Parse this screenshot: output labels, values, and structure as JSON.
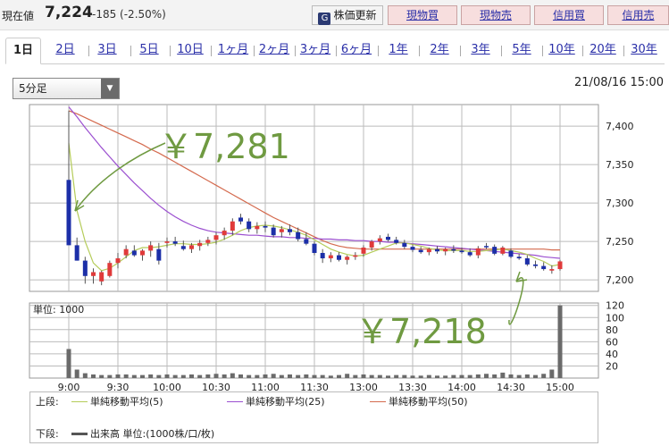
{
  "header": {
    "price_label": "現在値",
    "price": "7,224",
    "change": "-185 (-2.50%)",
    "update_label": "株価更新",
    "update_icon": "G",
    "buttons": [
      "現物買",
      "現物売",
      "信用買",
      "信用売"
    ]
  },
  "tabs": [
    "1日",
    "2日",
    "3日",
    "5日",
    "10日",
    "1ヶ月",
    "2ヶ月",
    "3ヶ月",
    "6ヶ月",
    "1年",
    "2年",
    "3年",
    "5年",
    "10年",
    "20年",
    "30年"
  ],
  "active_tab": "1日",
  "interval_select": {
    "value": "5分足",
    "arrow": "▼"
  },
  "datetime": "21/08/16 15:00",
  "annotations": {
    "high": "￥7,281",
    "low": "￥7,218"
  },
  "legend": {
    "upper_label": "上段:",
    "lower_label": "下段:",
    "items": [
      {
        "label": "単純移動平均(5)",
        "color": "#b5cc5a"
      },
      {
        "label": "単純移動平均(25)",
        "color": "#9b4fd0"
      },
      {
        "label": "単純移動平均(50)",
        "color": "#d46a4e"
      }
    ],
    "volume_item": {
      "label": "出来高 単位:(1000株/口/枚)",
      "color": "#555555"
    }
  },
  "chart_data": {
    "type": "candlestick",
    "price_axis": {
      "ticks": [
        7200,
        7250,
        7300,
        7350,
        7400
      ],
      "labels": [
        "7,200",
        "7,250",
        "7,300",
        "7,350",
        "7,400"
      ],
      "range": [
        7185,
        7428
      ]
    },
    "volume_axis": {
      "label": "単位: 1000",
      "ticks": [
        20,
        40,
        60,
        80,
        100,
        120
      ],
      "range": [
        0,
        124
      ]
    },
    "x_labels": [
      "9:00",
      "9:30",
      "10:00",
      "10:30",
      "11:00",
      "11:30",
      "13:00",
      "13:30",
      "14:00",
      "14:30",
      "15:00"
    ],
    "x_label_index": [
      0,
      6,
      12,
      18,
      24,
      30,
      36,
      42,
      48,
      54,
      60
    ],
    "colors": {
      "up": "#e03a3a",
      "down": "#1c2fa8",
      "volume": "#6a6a6a"
    },
    "candles": [
      [
        7330,
        7420,
        7250,
        7245
      ],
      [
        7245,
        7255,
        7225,
        7225
      ],
      [
        7225,
        7230,
        7195,
        7205
      ],
      [
        7205,
        7215,
        7195,
        7210
      ],
      [
        7198,
        7212,
        7193,
        7210
      ],
      [
        7205,
        7225,
        7203,
        7222
      ],
      [
        7222,
        7235,
        7215,
        7228
      ],
      [
        7232,
        7245,
        7228,
        7240
      ],
      [
        7238,
        7245,
        7230,
        7232
      ],
      [
        7232,
        7240,
        7225,
        7238
      ],
      [
        7238,
        7250,
        7230,
        7245
      ],
      [
        7240,
        7248,
        7220,
        7225
      ],
      [
        7248,
        7255,
        7242,
        7250
      ],
      [
        7250,
        7256,
        7244,
        7247
      ],
      [
        7244,
        7251,
        7238,
        7240
      ],
      [
        7240,
        7248,
        7235,
        7245
      ],
      [
        7244,
        7252,
        7238,
        7248
      ],
      [
        7248,
        7256,
        7244,
        7252
      ],
      [
        7252,
        7262,
        7246,
        7258
      ],
      [
        7258,
        7268,
        7252,
        7264
      ],
      [
        7264,
        7280,
        7258,
        7276
      ],
      [
        7281,
        7286,
        7272,
        7276
      ],
      [
        7276,
        7280,
        7262,
        7266
      ],
      [
        7266,
        7275,
        7260,
        7270
      ],
      [
        7270,
        7276,
        7262,
        7268
      ],
      [
        7268,
        7272,
        7255,
        7258
      ],
      [
        7262,
        7270,
        7255,
        7266
      ],
      [
        7266,
        7272,
        7258,
        7262
      ],
      [
        7262,
        7268,
        7250,
        7253
      ],
      [
        7253,
        7262,
        7245,
        7247
      ],
      [
        7247,
        7250,
        7232,
        7235
      ],
      [
        7235,
        7240,
        7222,
        7228
      ],
      [
        7228,
        7236,
        7223,
        7232
      ],
      [
        7232,
        7236,
        7224,
        7226
      ],
      [
        7226,
        7232,
        7220,
        7230
      ],
      [
        7230,
        7236,
        7226,
        7232
      ],
      [
        7234,
        7245,
        7230,
        7242
      ],
      [
        7242,
        7252,
        7238,
        7250
      ],
      [
        7250,
        7258,
        7246,
        7254
      ],
      [
        7256,
        7260,
        7250,
        7252
      ],
      [
        7252,
        7256,
        7246,
        7248
      ],
      [
        7248,
        7252,
        7240,
        7243
      ],
      [
        7243,
        7246,
        7236,
        7239
      ],
      [
        7239,
        7243,
        7234,
        7236
      ],
      [
        7236,
        7242,
        7232,
        7240
      ],
      [
        7240,
        7244,
        7234,
        7237
      ],
      [
        7237,
        7242,
        7232,
        7240
      ],
      [
        7240,
        7245,
        7235,
        7238
      ],
      [
        7238,
        7242,
        7234,
        7236
      ],
      [
        7236,
        7241,
        7230,
        7232
      ],
      [
        7232,
        7244,
        7228,
        7241
      ],
      [
        7244,
        7248,
        7240,
        7243
      ],
      [
        7243,
        7246,
        7232,
        7234
      ],
      [
        7234,
        7244,
        7232,
        7242
      ],
      [
        7238,
        7241,
        7228,
        7230
      ],
      [
        7230,
        7234,
        7226,
        7228
      ],
      [
        7228,
        7232,
        7218,
        7220
      ],
      [
        7220,
        7225,
        7215,
        7218
      ],
      [
        7218,
        7223,
        7212,
        7214
      ],
      [
        7212,
        7219,
        7208,
        7214
      ],
      [
        7214,
        7226,
        7212,
        7224
      ]
    ],
    "sma5": [
      7378,
      7290,
      7250,
      7222,
      7212,
      7215,
      7222,
      7230,
      7238,
      7242,
      7242,
      7243,
      7245,
      7247,
      7247,
      7246,
      7246,
      7247,
      7249,
      7253,
      7258,
      7264,
      7268,
      7270,
      7271,
      7270,
      7268,
      7265,
      7262,
      7258,
      7252,
      7246,
      7240,
      7236,
      7233,
      7231,
      7232,
      7236,
      7240,
      7244,
      7248,
      7248,
      7246,
      7244,
      7241,
      7239,
      7238,
      7238,
      7238,
      7237,
      7237,
      7238,
      7239,
      7240,
      7238,
      7236,
      7233,
      7228,
      7224,
      7218,
      7220
    ],
    "sma25": [
      7425,
      7412,
      7398,
      7385,
      7372,
      7360,
      7348,
      7337,
      7326,
      7316,
      7306,
      7297,
      7289,
      7282,
      7276,
      7271,
      7267,
      7264,
      7262,
      7261,
      7260,
      7259,
      7258,
      7258,
      7257,
      7256,
      7256,
      7255,
      7255,
      7254,
      7254,
      7253,
      7253,
      7252,
      7252,
      7251,
      7251,
      7250,
      7250,
      7249,
      7249,
      7248,
      7247,
      7246,
      7245,
      7244,
      7243,
      7242,
      7241,
      7240,
      7239,
      7238,
      7237,
      7236,
      7235,
      7234,
      7233,
      7232,
      7230,
      7229,
      7228
    ],
    "sma50": [
      7420,
      7416,
      7411,
      7406,
      7401,
      7396,
      7391,
      7386,
      7381,
      7376,
      7370,
      7365,
      7359,
      7353,
      7347,
      7341,
      7335,
      7329,
      7323,
      7317,
      7311,
      7305,
      7299,
      7293,
      7287,
      7281,
      7276,
      7271,
      7266,
      7261,
      7256,
      7251,
      7247,
      7244,
      7242,
      7241,
      7240,
      7240,
      7240,
      7240,
      7240,
      7240,
      7240,
      7240,
      7240,
      7240,
      7240,
      7240,
      7240,
      7240,
      7240,
      7240,
      7240,
      7240,
      7240,
      7240,
      7240,
      7240,
      7240,
      7239,
      7239
    ],
    "volume": [
      48,
      14,
      8,
      6,
      5,
      5,
      6,
      6,
      5,
      5,
      6,
      5,
      6,
      5,
      5,
      6,
      5,
      6,
      7,
      6,
      8,
      6,
      5,
      5,
      6,
      7,
      5,
      6,
      5,
      6,
      5,
      5,
      4,
      5,
      7,
      5,
      6,
      5,
      5,
      4,
      5,
      5,
      4,
      4,
      5,
      4,
      4,
      5,
      5,
      5,
      6,
      7,
      6,
      9,
      6,
      5,
      6,
      5,
      7,
      14,
      120
    ]
  }
}
